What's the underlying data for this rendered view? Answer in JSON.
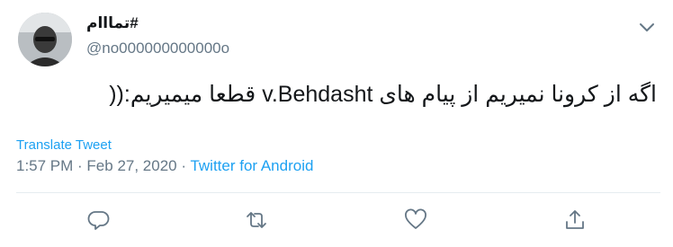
{
  "user": {
    "display_name": "#تمااام",
    "handle": "@no000000000000o"
  },
  "tweet": {
    "text": "اگه از کرونا نمیریم از پیام های v.Behdasht قطعا میمیریم:((",
    "translate_label": "Translate Tweet",
    "time": "1:57 PM",
    "separator": " · ",
    "date": "Feb 27, 2020",
    "source": "Twitter for Android"
  },
  "icons": {
    "menu": "chevron-down-icon",
    "reply": "reply-icon",
    "retweet": "retweet-icon",
    "like": "heart-icon",
    "share": "share-icon"
  },
  "colors": {
    "text": "#14171a",
    "secondary": "#657786",
    "link": "#1da1f2",
    "divider": "#e6ecf0"
  }
}
